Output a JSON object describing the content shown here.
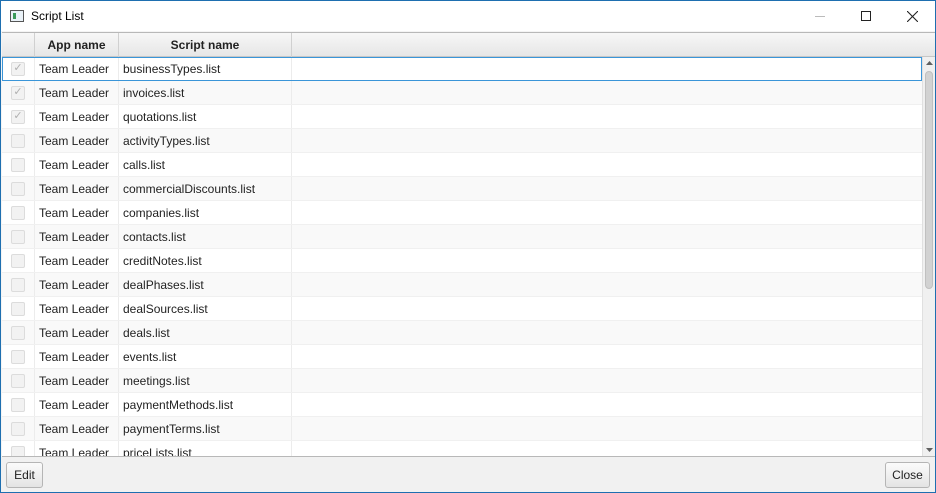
{
  "window": {
    "title": "Script List",
    "controls": {
      "minimize": "minimize-icon",
      "maximize": "maximize-icon",
      "close": "close-icon"
    }
  },
  "table": {
    "columns": [
      "",
      "App name",
      "Script name",
      ""
    ],
    "rows": [
      {
        "checked": true,
        "app": "Team Leader",
        "script": "businessTypes.list"
      },
      {
        "checked": true,
        "app": "Team Leader",
        "script": "invoices.list"
      },
      {
        "checked": true,
        "app": "Team Leader",
        "script": "quotations.list"
      },
      {
        "checked": false,
        "app": "Team Leader",
        "script": "activityTypes.list"
      },
      {
        "checked": false,
        "app": "Team Leader",
        "script": "calls.list"
      },
      {
        "checked": false,
        "app": "Team Leader",
        "script": "commercialDiscounts.list"
      },
      {
        "checked": false,
        "app": "Team Leader",
        "script": "companies.list"
      },
      {
        "checked": false,
        "app": "Team Leader",
        "script": "contacts.list"
      },
      {
        "checked": false,
        "app": "Team Leader",
        "script": "creditNotes.list"
      },
      {
        "checked": false,
        "app": "Team Leader",
        "script": "dealPhases.list"
      },
      {
        "checked": false,
        "app": "Team Leader",
        "script": "dealSources.list"
      },
      {
        "checked": false,
        "app": "Team Leader",
        "script": "deals.list"
      },
      {
        "checked": false,
        "app": "Team Leader",
        "script": "events.list"
      },
      {
        "checked": false,
        "app": "Team Leader",
        "script": "meetings.list"
      },
      {
        "checked": false,
        "app": "Team Leader",
        "script": "paymentMethods.list"
      },
      {
        "checked": false,
        "app": "Team Leader",
        "script": "paymentTerms.list"
      },
      {
        "checked": false,
        "app": "Team Leader",
        "script": "priceLists.list"
      }
    ]
  },
  "footer": {
    "edit_label": "Edit",
    "close_label": "Close"
  }
}
